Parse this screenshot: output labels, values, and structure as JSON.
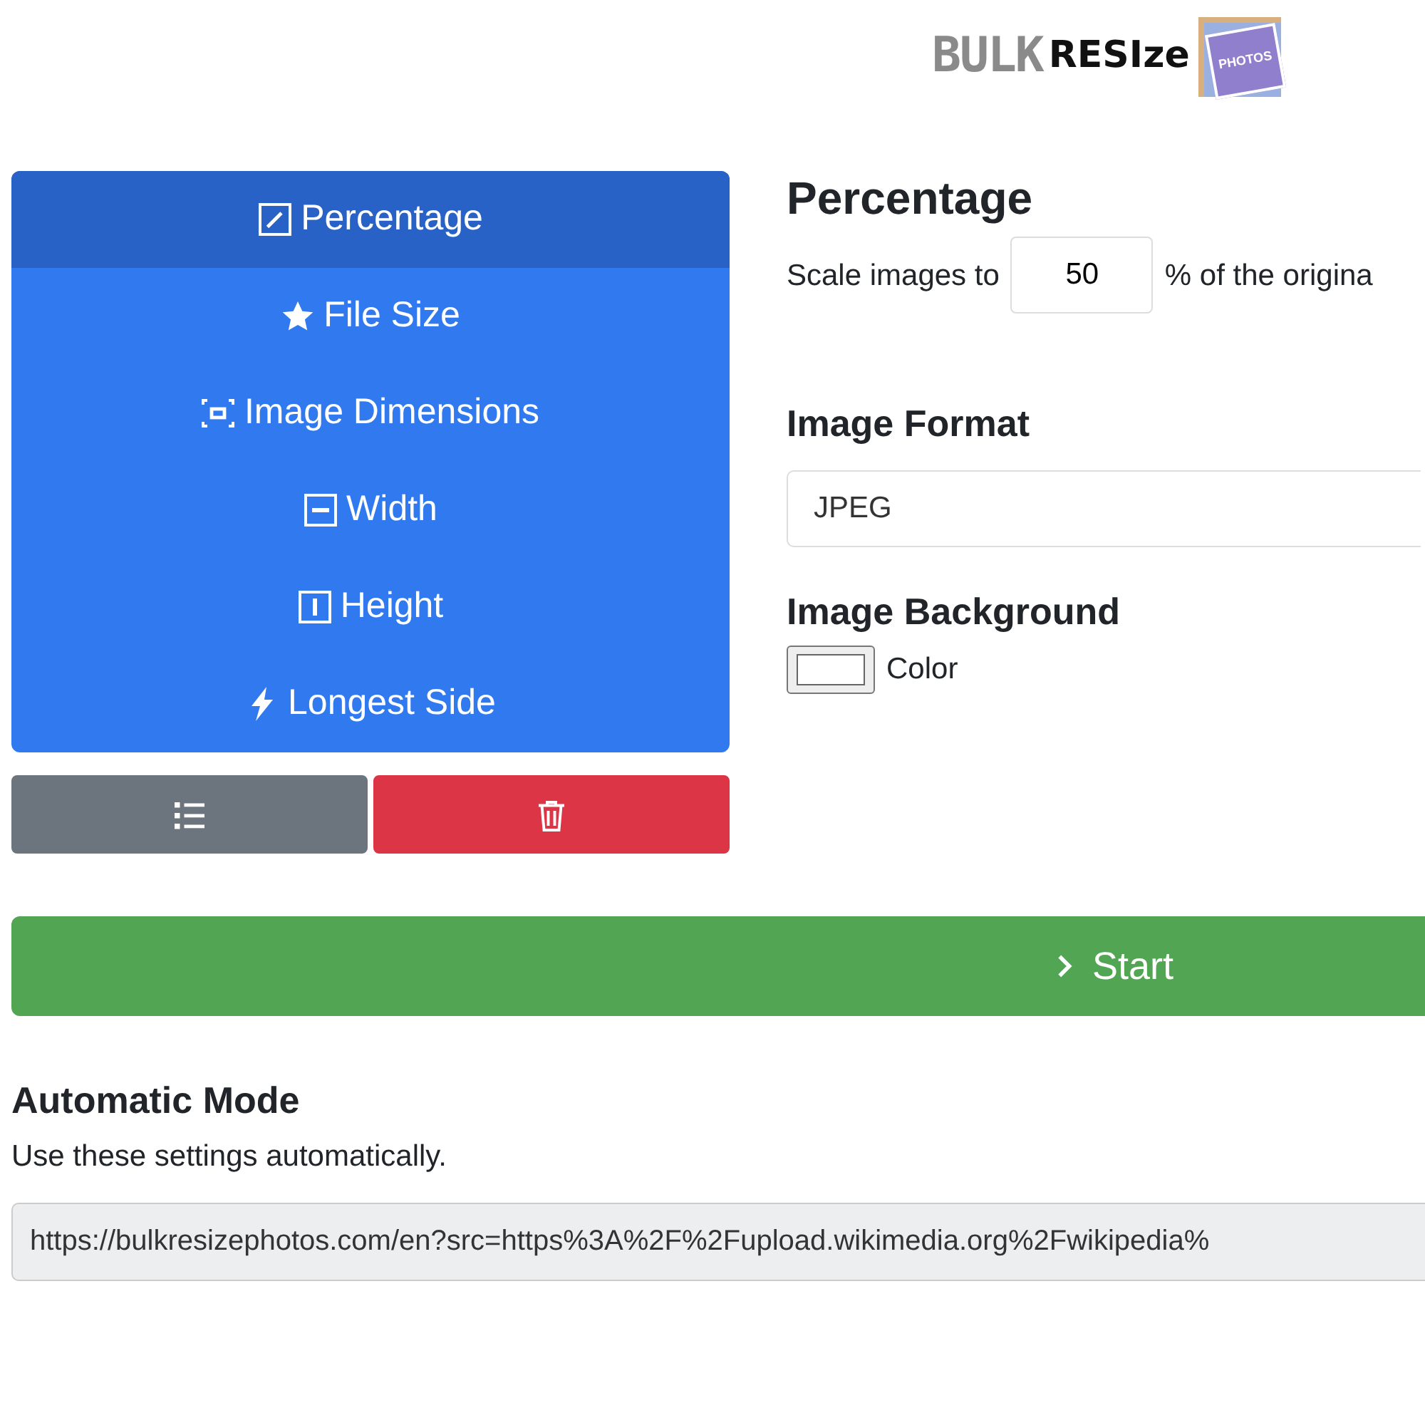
{
  "logo": {
    "word_1": "BULK",
    "word_2": "RESIze",
    "badge": "PHOTOS"
  },
  "modes": [
    {
      "label": "Percentage",
      "kind": "percentage",
      "selected": true
    },
    {
      "label": "File Size",
      "kind": "filesize",
      "selected": false
    },
    {
      "label": "Image Dimensions",
      "kind": "dimensions",
      "selected": false
    },
    {
      "label": "Width",
      "kind": "width",
      "selected": false
    },
    {
      "label": "Height",
      "kind": "height",
      "selected": false
    },
    {
      "label": "Longest Side",
      "kind": "longest",
      "selected": false
    }
  ],
  "percentage": {
    "title": "Percentage",
    "prefix": "Scale images to",
    "value": "50",
    "suffix": "% of the origina"
  },
  "format": {
    "title": "Image Format",
    "value": "JPEG"
  },
  "background": {
    "title": "Image Background",
    "label": "Color"
  },
  "start_button": "Start",
  "automatic": {
    "title": "Automatic Mode",
    "text": "Use these settings automatically.",
    "url": "https://bulkresizephotos.com/en?src=https%3A%2F%2Fupload.wikimedia.org%2Fwikipedia%"
  }
}
